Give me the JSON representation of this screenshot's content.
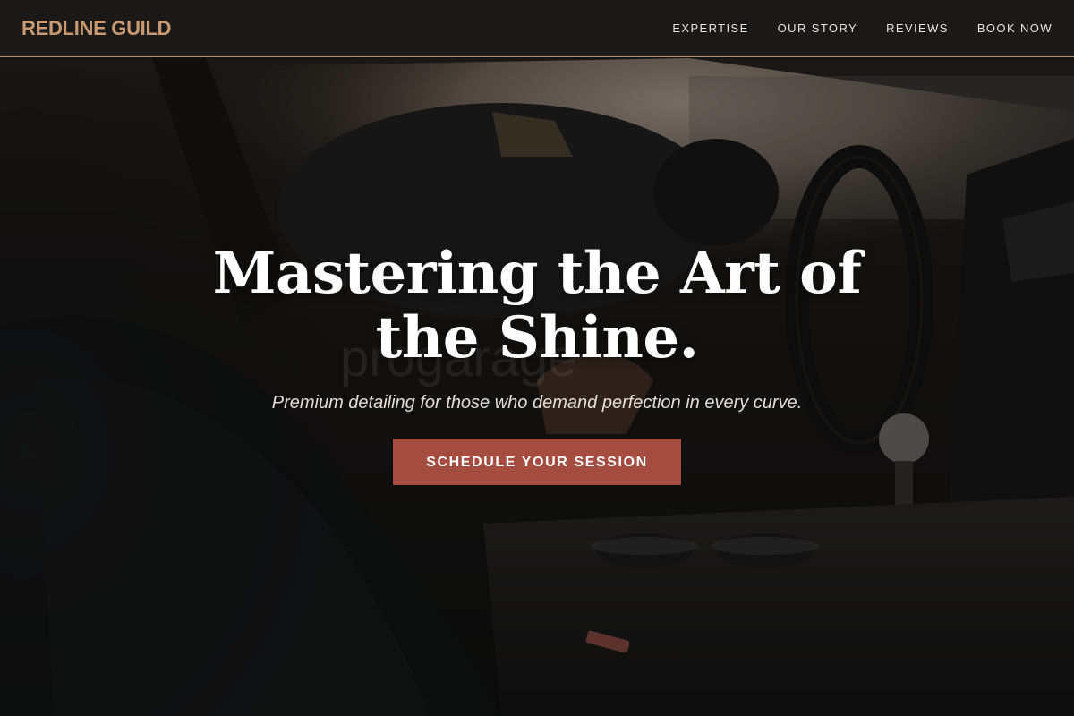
{
  "header": {
    "brand": "REDLINE GUILD",
    "nav": [
      {
        "label": "EXPERTISE"
      },
      {
        "label": "OUR STORY"
      },
      {
        "label": "REVIEWS"
      },
      {
        "label": "BOOK NOW"
      }
    ]
  },
  "hero": {
    "title": "Mastering the Art of the Shine.",
    "subtitle": "Premium detailing for those who demand perfection in every curve.",
    "cta_label": "SCHEDULE YOUR SESSION",
    "watermark": "progarage"
  },
  "colors": {
    "brand": "#c99a72",
    "accent": "#a54c41",
    "header_bg": "#1a1918",
    "header_border": "#b88f6a"
  }
}
